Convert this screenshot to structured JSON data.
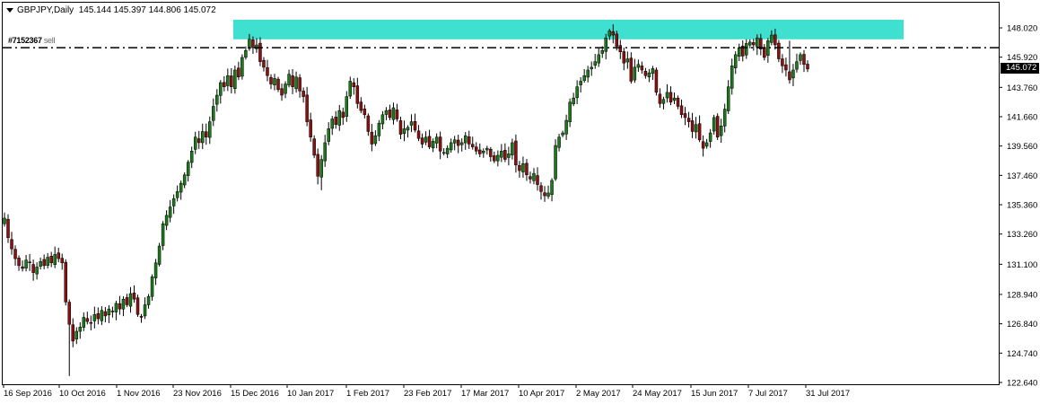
{
  "header": {
    "symbol": "GBPJPY,Daily",
    "ohlc": "145.144 145.397 144.806 145.072"
  },
  "order_label": {
    "ticket": "#7152367",
    "type": "sell"
  },
  "current_price": "145.072",
  "colors": {
    "bull": "#1a7a1a",
    "bear": "#8b1010",
    "zone": "#40e0d0",
    "grid": "#000000"
  },
  "chart_data": {
    "type": "candlestick",
    "symbol": "GBPJPY",
    "timeframe": "Daily",
    "ylim": [
      122.64,
      149.2
    ],
    "price_ticks": [
      "148.020",
      "145.920",
      "143.760",
      "141.660",
      "139.560",
      "137.460",
      "135.360",
      "133.260",
      "131.100",
      "128.940",
      "126.840",
      "124.740",
      "122.640"
    ],
    "date_ticks": [
      "16 Sep 2016",
      "10 Oct 2016",
      "1 Nov 2016",
      "23 Nov 2016",
      "15 Dec 2016",
      "10 Jan 2017",
      "1 Feb 2017",
      "23 Feb 2017",
      "17 Mar 2017",
      "10 Apr 2017",
      "2 May 2017",
      "24 May 2017",
      "15 Jun 2017",
      "7 Jul 2017",
      "31 Jul 2017"
    ],
    "sell_order_price": 146.6,
    "resistance_zone": [
      147.2,
      148.6
    ],
    "closes": [
      134.4,
      133.0,
      132.2,
      131.5,
      131.0,
      130.8,
      131.4,
      131.2,
      130.5,
      130.9,
      131.3,
      131.0,
      131.6,
      131.2,
      131.8,
      131.5,
      131.2,
      128.4,
      126.8,
      125.6,
      126.3,
      126.6,
      127.3,
      127.0,
      126.9,
      127.5,
      127.2,
      127.8,
      127.4,
      127.9,
      127.7,
      128.3,
      127.9,
      128.6,
      128.2,
      129.0,
      128.6,
      127.5,
      127.3,
      128.2,
      128.8,
      130.2,
      131.2,
      132.4,
      134.0,
      134.6,
      135.2,
      135.8,
      136.3,
      136.9,
      137.5,
      138.4,
      139.2,
      140.2,
      139.8,
      140.6,
      140.2,
      141.3,
      142.4,
      143.2,
      144.1,
      143.8,
      144.6,
      143.8,
      145.0,
      144.5,
      145.9,
      146.4,
      147.2,
      146.6,
      146.8,
      145.6,
      145.2,
      144.6,
      144.0,
      144.4,
      143.6,
      143.2,
      144.0,
      144.7,
      143.8,
      144.5,
      143.5,
      143.1,
      141.3,
      140.2,
      138.9,
      137.4,
      138.6,
      139.8,
      140.8,
      141.5,
      141.1,
      142.1,
      141.6,
      143.1,
      144.2,
      143.8,
      142.6,
      142.1,
      141.8,
      140.6,
      139.7,
      140.3,
      141.2,
      141.8,
      142.1,
      141.6,
      142.3,
      141.5,
      140.4,
      140.8,
      140.9,
      141.3,
      140.7,
      140.1,
      139.7,
      140.2,
      139.5,
      139.9,
      140.2,
      139.2,
      139.1,
      139.4,
      139.8,
      140.0,
      139.6,
      139.8,
      140.3,
      139.7,
      139.5,
      139.2,
      139.0,
      139.2,
      139.4,
      138.8,
      138.5,
      138.9,
      139.2,
      138.6,
      139.0,
      139.8,
      138.2,
      137.8,
      138.3,
      137.5,
      137.2,
      137.6,
      136.8,
      136.3,
      136.0,
      136.2,
      137.1,
      139.6,
      140.2,
      140.5,
      141.4,
      142.7,
      143.0,
      143.8,
      144.2,
      144.6,
      145.0,
      145.2,
      145.6,
      146.1,
      146.4,
      147.3,
      147.8,
      147.5,
      146.7,
      146.3,
      145.5,
      145.8,
      144.2,
      145.2,
      145.4,
      145.0,
      144.6,
      144.8,
      145.1,
      143.4,
      142.6,
      142.9,
      143.4,
      142.7,
      143.0,
      142.4,
      141.8,
      141.6,
      141.3,
      140.6,
      141.1,
      140.0,
      139.4,
      139.8,
      140.5,
      141.6,
      140.2,
      141.0,
      142.2,
      143.8,
      145.3,
      146.1,
      146.6,
      146.0,
      146.9,
      147.0,
      146.8,
      147.3,
      146.5,
      145.9,
      147.1,
      147.5,
      146.8,
      145.8,
      145.3,
      145.0,
      144.3,
      145.0,
      145.6,
      146.1,
      145.4,
      145.072
    ]
  }
}
